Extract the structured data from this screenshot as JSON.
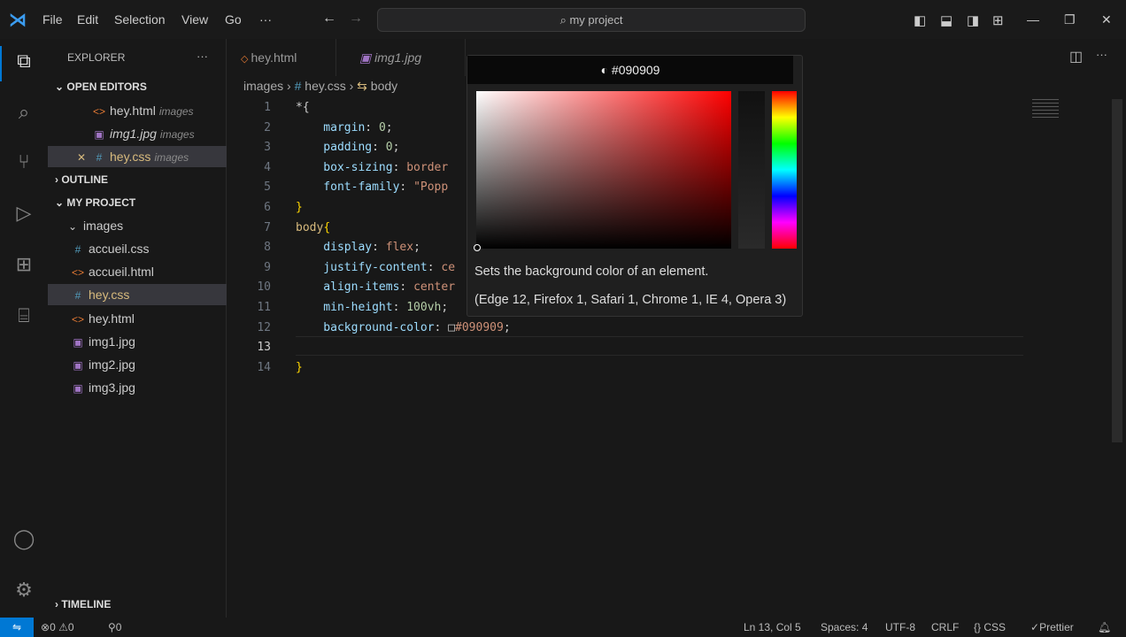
{
  "menu": [
    "File",
    "Edit",
    "Selection",
    "View",
    "Go",
    "···"
  ],
  "search": "my project",
  "sidebar": {
    "title": "EXPLORER",
    "more": "···",
    "open_editors": "OPEN EDITORS",
    "open": [
      {
        "name": "hey.html",
        "desc": "images",
        "icon": "<>"
      },
      {
        "name": "img1.jpg",
        "desc": "images",
        "icon": "▣"
      },
      {
        "name": "hey.css",
        "desc": "images",
        "icon": "#"
      }
    ],
    "outline": "OUTLINE",
    "project": "MY PROJECT",
    "folder": "images",
    "files": [
      {
        "name": "accueil.css",
        "icon": "#"
      },
      {
        "name": "accueil.html",
        "icon": "<>"
      },
      {
        "name": "hey.css",
        "icon": "#"
      },
      {
        "name": "hey.html",
        "icon": "<>"
      },
      {
        "name": "img1.jpg",
        "icon": "▣"
      },
      {
        "name": "img2.jpg",
        "icon": "▣"
      },
      {
        "name": "img3.jpg",
        "icon": "▣"
      }
    ],
    "timeline": "TIMELINE"
  },
  "tabs": [
    {
      "label": "hey.html"
    },
    {
      "label": "img1.jpg"
    }
  ],
  "breadcrumb": {
    "folder": "images",
    "file": "hey.css",
    "symbol": "body"
  },
  "code": [
    [
      [
        "*{",
        "s"
      ]
    ],
    [
      [
        "    margin",
        "p"
      ],
      [
        ": ",
        "s"
      ],
      [
        "0",
        "n"
      ],
      [
        ";",
        "s"
      ]
    ],
    [
      [
        "    padding",
        "p"
      ],
      [
        ": ",
        "s"
      ],
      [
        "0",
        "n"
      ],
      [
        ";",
        "s"
      ]
    ],
    [
      [
        "    box-sizing",
        "p"
      ],
      [
        ": ",
        "s"
      ],
      [
        "border",
        "v"
      ]
    ],
    [
      [
        "    font-family",
        "p"
      ],
      [
        ": ",
        "s"
      ],
      [
        "\"Popp",
        "v"
      ]
    ],
    [
      [
        "}",
        "b"
      ]
    ],
    [
      [
        "body",
        "sel"
      ],
      [
        "{",
        "b"
      ]
    ],
    [
      [
        "    display",
        "p"
      ],
      [
        ": ",
        "s"
      ],
      [
        "flex",
        "v"
      ],
      [
        ";",
        "s"
      ]
    ],
    [
      [
        "    justify-content",
        "p"
      ],
      [
        ": ",
        "s"
      ],
      [
        "ce",
        "v"
      ]
    ],
    [
      [
        "    align-items",
        "p"
      ],
      [
        ": ",
        "s"
      ],
      [
        "center",
        "v"
      ]
    ],
    [
      [
        "    min-height",
        "p"
      ],
      [
        ": ",
        "s"
      ],
      [
        "100vh",
        "n"
      ],
      [
        ";",
        "s"
      ]
    ],
    [
      [
        "    background-color",
        "p"
      ],
      [
        ": ",
        "s"
      ],
      [
        "□",
        "s"
      ],
      [
        "#090909",
        "v"
      ],
      [
        ";",
        "s"
      ]
    ],
    [
      [
        "",
        "s"
      ]
    ],
    [
      [
        "}",
        "b"
      ]
    ]
  ],
  "picker": {
    "color": "#090909",
    "hover_desc": "Sets the background color of an element.",
    "hover_compat": "(Edge 12, Firefox 1, Safari 1, Chrome 1, IE 4, Opera 3)"
  },
  "status": {
    "errors": "0",
    "warnings": "0",
    "ports": "0",
    "position": "Ln 13, Col 5",
    "spaces": "Spaces: 4",
    "encoding": "UTF-8",
    "eol": "CRLF",
    "language": "CSS",
    "prettier": "Prettier"
  }
}
